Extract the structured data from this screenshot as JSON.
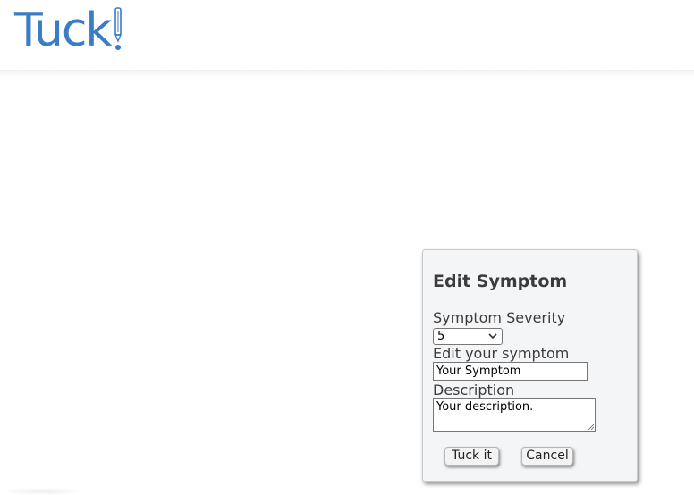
{
  "header": {
    "logo_text": "Tuck",
    "logo_mark": "!"
  },
  "dialog": {
    "title": "Edit Symptom",
    "severity_label": "Symptom Severity",
    "severity_value": "5",
    "symptom_label": "Edit your symptom",
    "symptom_value": "Your Symptom",
    "description_label": "Description",
    "description_value": "Your description.",
    "submit_label": "Tuck it",
    "cancel_label": "Cancel"
  },
  "colors": {
    "brand": "#3a7dc4",
    "dialog_bg": "#f4f5f7"
  },
  "icons": {
    "logo": "pen-exclamation-icon",
    "select": "chevron-down-icon",
    "textarea": "resize-grip-icon"
  }
}
